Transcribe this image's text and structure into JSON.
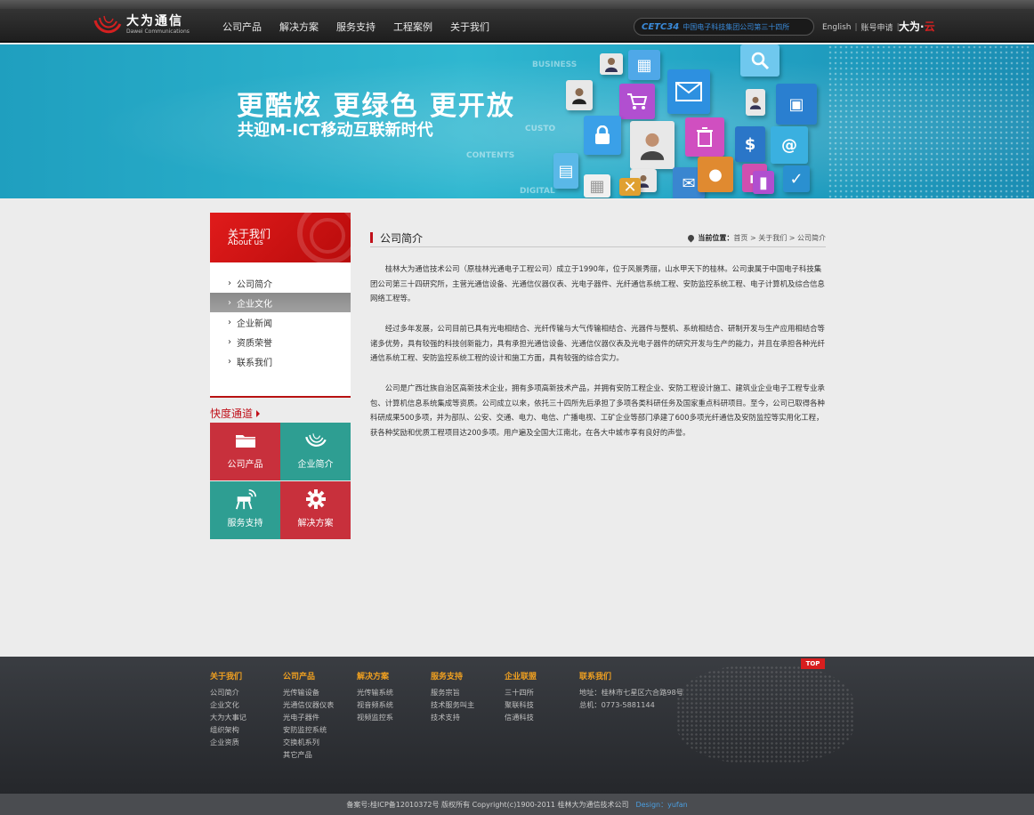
{
  "header": {
    "logo_cn": "大为通信",
    "logo_en": "Dawei Communications",
    "nav": [
      "公司产品",
      "解决方案",
      "服务支持",
      "工程案例",
      "关于我们"
    ],
    "cetc_logo": "CETC34",
    "cetc_text": "中国电子科技集团公司第三十四所",
    "english": "English",
    "account": "账号申请",
    "dawei_cloud_prefix": "大为·",
    "dawei_cloud_suffix": "云"
  },
  "banner": {
    "slogan1": "更酷炫 更绿色 更开放",
    "slogan2": "共迎M-ICT移动互联新时代",
    "words": [
      "BUSINESS",
      "CUSTO",
      "CONTENTS",
      "DIGITAL"
    ]
  },
  "sidebar": {
    "title": "关于我们",
    "subtitle": "About us",
    "items": [
      "公司简介",
      "企业文化",
      "企业新闻",
      "资质荣誉",
      "联系我们"
    ],
    "active_index": 1,
    "quick_title": "快度通道",
    "quick": [
      "公司产品",
      "企业简介",
      "服务支持",
      "解决方案"
    ]
  },
  "content": {
    "title": "公司简介",
    "crumb_label": "当前位置：",
    "crumb_path": "首页 > 关于我们 > 公司简介",
    "paragraphs": [
      "桂林大为通信技术公司（原桂林光通电子工程公司）成立于1990年，位于风景秀丽，山水甲天下的桂林。公司隶属于中国电子科技集团公司第三十四研究所，主营光通信设备、光通信仪器仪表、光电子器件、光纤通信系统工程、安防监控系统工程、电子计算机及综合信息网络工程等。",
      "经过多年发展，公司目前已具有光电相结合、光纤传输与大气传输相结合、光器件与整机、系统相结合、研制开发与生产应用相结合等诸多优势，具有较强的科技创新能力，具有承担光通信设备、光通信仪器仪表及光电子器件的研究开发与生产的能力，并且在承担各种光纤通信系统工程、安防监控系统工程的设计和施工方面，具有较强的综合实力。",
      "公司是广西壮族自治区高新技术企业，拥有多项高新技术产品，并拥有安防工程企业、安防工程设计施工、建筑业企业电子工程专业承包、计算机信息系统集成等资质。公司成立以来，依托三十四所先后承担了多项各类科研任务及国家重点科研项目。至今，公司已取得各种科研成果500多项，并为部队、公安、交通、电力、电信、广播电视、工矿企业等部门承建了600多项光纤通信及安防监控等实用化工程，获各种奖励和优质工程项目达200多项。用户遍及全国大江南北，在各大中城市享有良好的声誉。"
    ]
  },
  "footer": {
    "columns": [
      {
        "title": "关于我们",
        "items": [
          "公司简介",
          "企业文化",
          "大为大事记",
          "组织架构",
          "企业资质"
        ]
      },
      {
        "title": "公司产品",
        "items": [
          "光传输设备",
          "光通信仪器仪表",
          "光电子器件",
          "安防监控系统",
          "交换机系列",
          "其它产品"
        ]
      },
      {
        "title": "解决方案",
        "items": [
          "光传输系统",
          "视音频系统",
          "视频监控系",
          ""
        ]
      },
      {
        "title": "服务支持",
        "items": [
          "服务宗旨",
          "技术服务叫主",
          "技术支持"
        ]
      },
      {
        "title": "企业联盟",
        "items": [
          "三十四所",
          "聚联科技",
          "信通科技"
        ]
      },
      {
        "title": "联系我们",
        "items": [
          "地址：桂林市七星区六合路98号",
          "总机：0773-5881144"
        ]
      }
    ],
    "top": "TOP",
    "copyright": "备案号:桂ICP备12010372号  版权所有 Copyright(c)1900-2011  桂林大为通信技术公司",
    "design": "Design：yufan"
  }
}
